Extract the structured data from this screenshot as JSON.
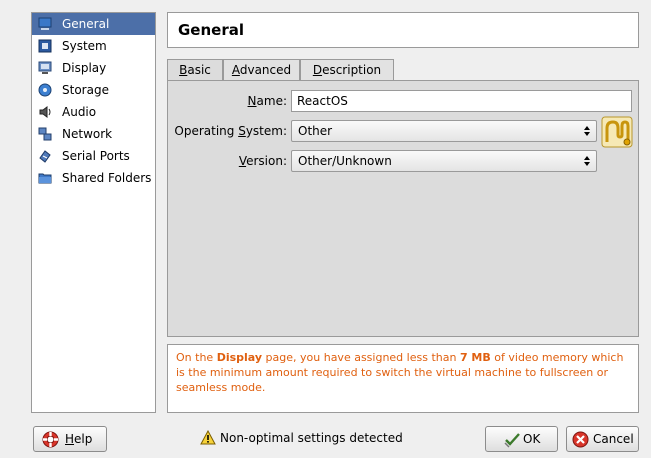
{
  "sidebar": {
    "items": [
      {
        "label": "General",
        "icon": "general-icon",
        "selected": true
      },
      {
        "label": "System",
        "icon": "system-icon"
      },
      {
        "label": "Display",
        "icon": "display-icon"
      },
      {
        "label": "Storage",
        "icon": "storage-icon"
      },
      {
        "label": "Audio",
        "icon": "audio-icon"
      },
      {
        "label": "Network",
        "icon": "network-icon"
      },
      {
        "label": "Serial Ports",
        "icon": "serial-ports-icon"
      },
      {
        "label": "Shared Folders",
        "icon": "shared-folders-icon"
      }
    ]
  },
  "page": {
    "title": "General"
  },
  "tabs": {
    "basic": "B",
    "basic_rest": "asic",
    "advanced": "A",
    "advanced_rest": "dvanced",
    "description": "D",
    "description_rest": "escription",
    "active": "Basic"
  },
  "basic": {
    "name_label": "N",
    "name_label_rest": "ame:",
    "name_value": "ReactOS",
    "os_label_pre": "Operating ",
    "os_label_ul": "S",
    "os_label_rest": "ystem:",
    "os_value": "Other",
    "version_label": "V",
    "version_label_rest": "ersion:",
    "version_value": "Other/Unknown"
  },
  "warning": {
    "pre": "On the ",
    "page": "Display",
    "mid": " page, you have assigned less than ",
    "amount": "7 MB",
    "post": " of video memory which is the minimum amount required to switch the virtual machine to fullscreen or seamless mode."
  },
  "status": {
    "text": "Non-optimal settings detected"
  },
  "buttons": {
    "help_ul": "H",
    "help_rest": "elp",
    "ok": "OK",
    "cancel": "Cancel"
  },
  "colors": {
    "selection": "#4c6fa8",
    "warning_text": "#e06010"
  }
}
